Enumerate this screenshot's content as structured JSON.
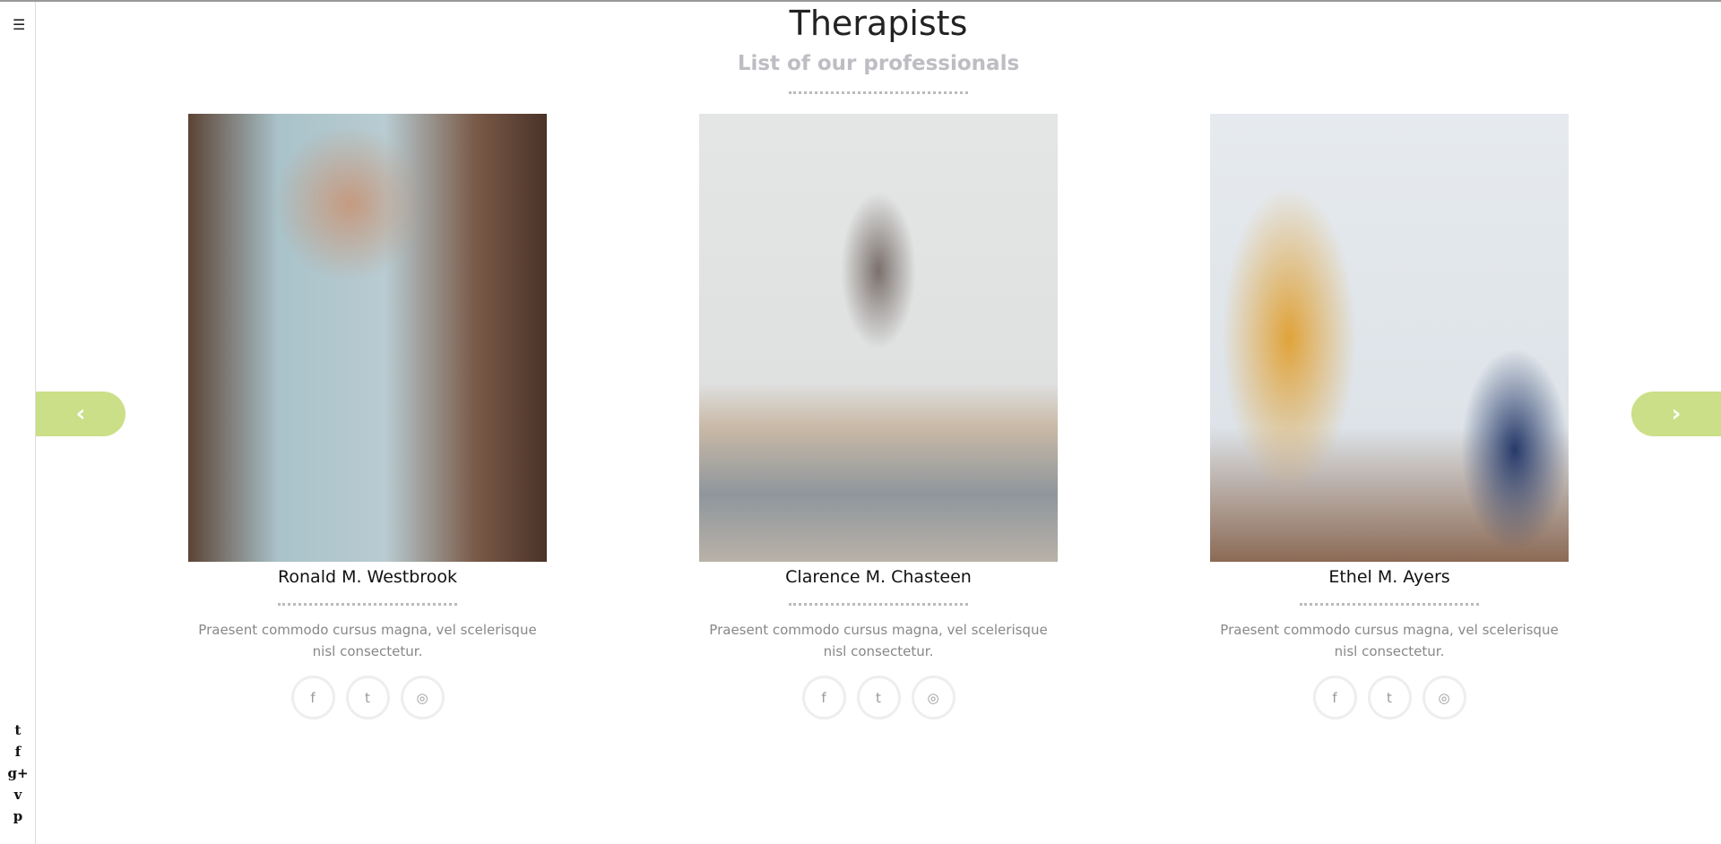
{
  "sidebar": {
    "menu_icon": "☰",
    "social": [
      {
        "icon": "twitter-icon",
        "glyph": "🐦︎"
      },
      {
        "icon": "facebook-icon",
        "glyph": "f"
      },
      {
        "icon": "google-plus-icon",
        "glyph": "g+"
      },
      {
        "icon": "vimeo-icon",
        "glyph": "v"
      },
      {
        "icon": "pinterest-icon",
        "glyph": "p"
      }
    ]
  },
  "header": {
    "title": "Therapists",
    "subtitle": "List of our professionals"
  },
  "accent_color": "#cbdf88",
  "carousel": {
    "prev": "‹",
    "next": "›"
  },
  "therapists": [
    {
      "name": "Ronald M. Westbrook",
      "description": "Praesent commodo cursus magna, vel scelerisque nisl consectetur."
    },
    {
      "name": "Clarence M. Chasteen",
      "description": "Praesent commodo cursus magna, vel scelerisque nisl consectetur."
    },
    {
      "name": "Ethel M. Ayers",
      "description": "Praesent commodo cursus magna, vel scelerisque nisl consectetur."
    }
  ],
  "card_social": {
    "facebook": "f",
    "twitter": "t",
    "instagram": "◎"
  }
}
